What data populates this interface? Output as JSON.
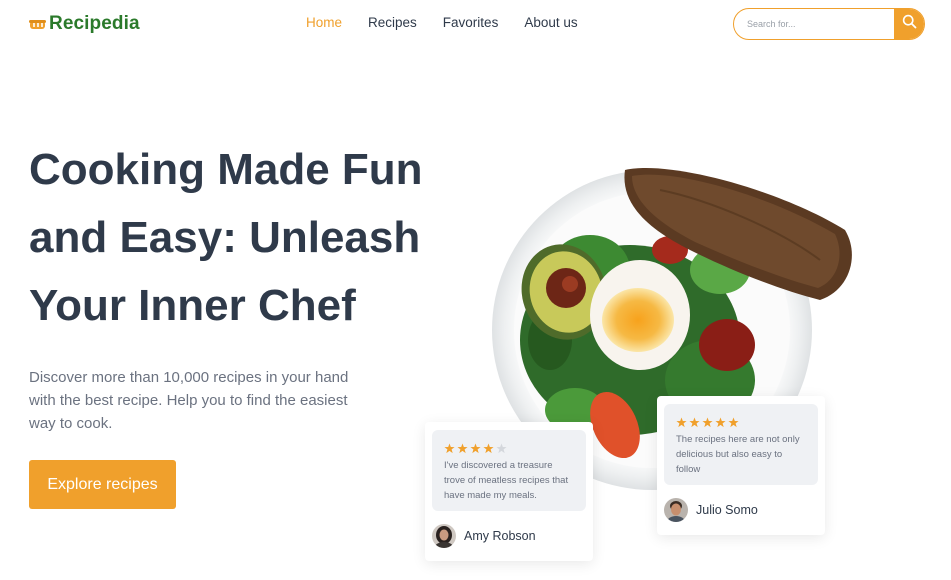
{
  "brand": {
    "name": "Recipedia",
    "icon": "pot-icon",
    "color": "#2b7a2b",
    "accent": "#f0a02c"
  },
  "nav": {
    "items": [
      {
        "label": "Home",
        "active": true
      },
      {
        "label": "Recipes",
        "active": false
      },
      {
        "label": "Favorites",
        "active": false
      },
      {
        "label": "About us",
        "active": false
      }
    ]
  },
  "search": {
    "placeholder": "Search for...",
    "value": "",
    "icon": "search-icon"
  },
  "hero": {
    "title": "Cooking Made Fun and Easy: Unleash Your Inner Chef",
    "description": "Discover more than 10,000 recipes in your hand with the best recipe. Help you to find the easiest way to cook.",
    "cta_label": "Explore recipes"
  },
  "reviews": [
    {
      "rating": 4,
      "max_rating": 5,
      "text": "I've discovered a treasure trove of meatless recipes that have made my meals.",
      "author": "Amy Robson"
    },
    {
      "rating": 5,
      "max_rating": 5,
      "text": "The recipes here are not only delicious but also easy to follow",
      "author": "Julio Somo"
    }
  ]
}
